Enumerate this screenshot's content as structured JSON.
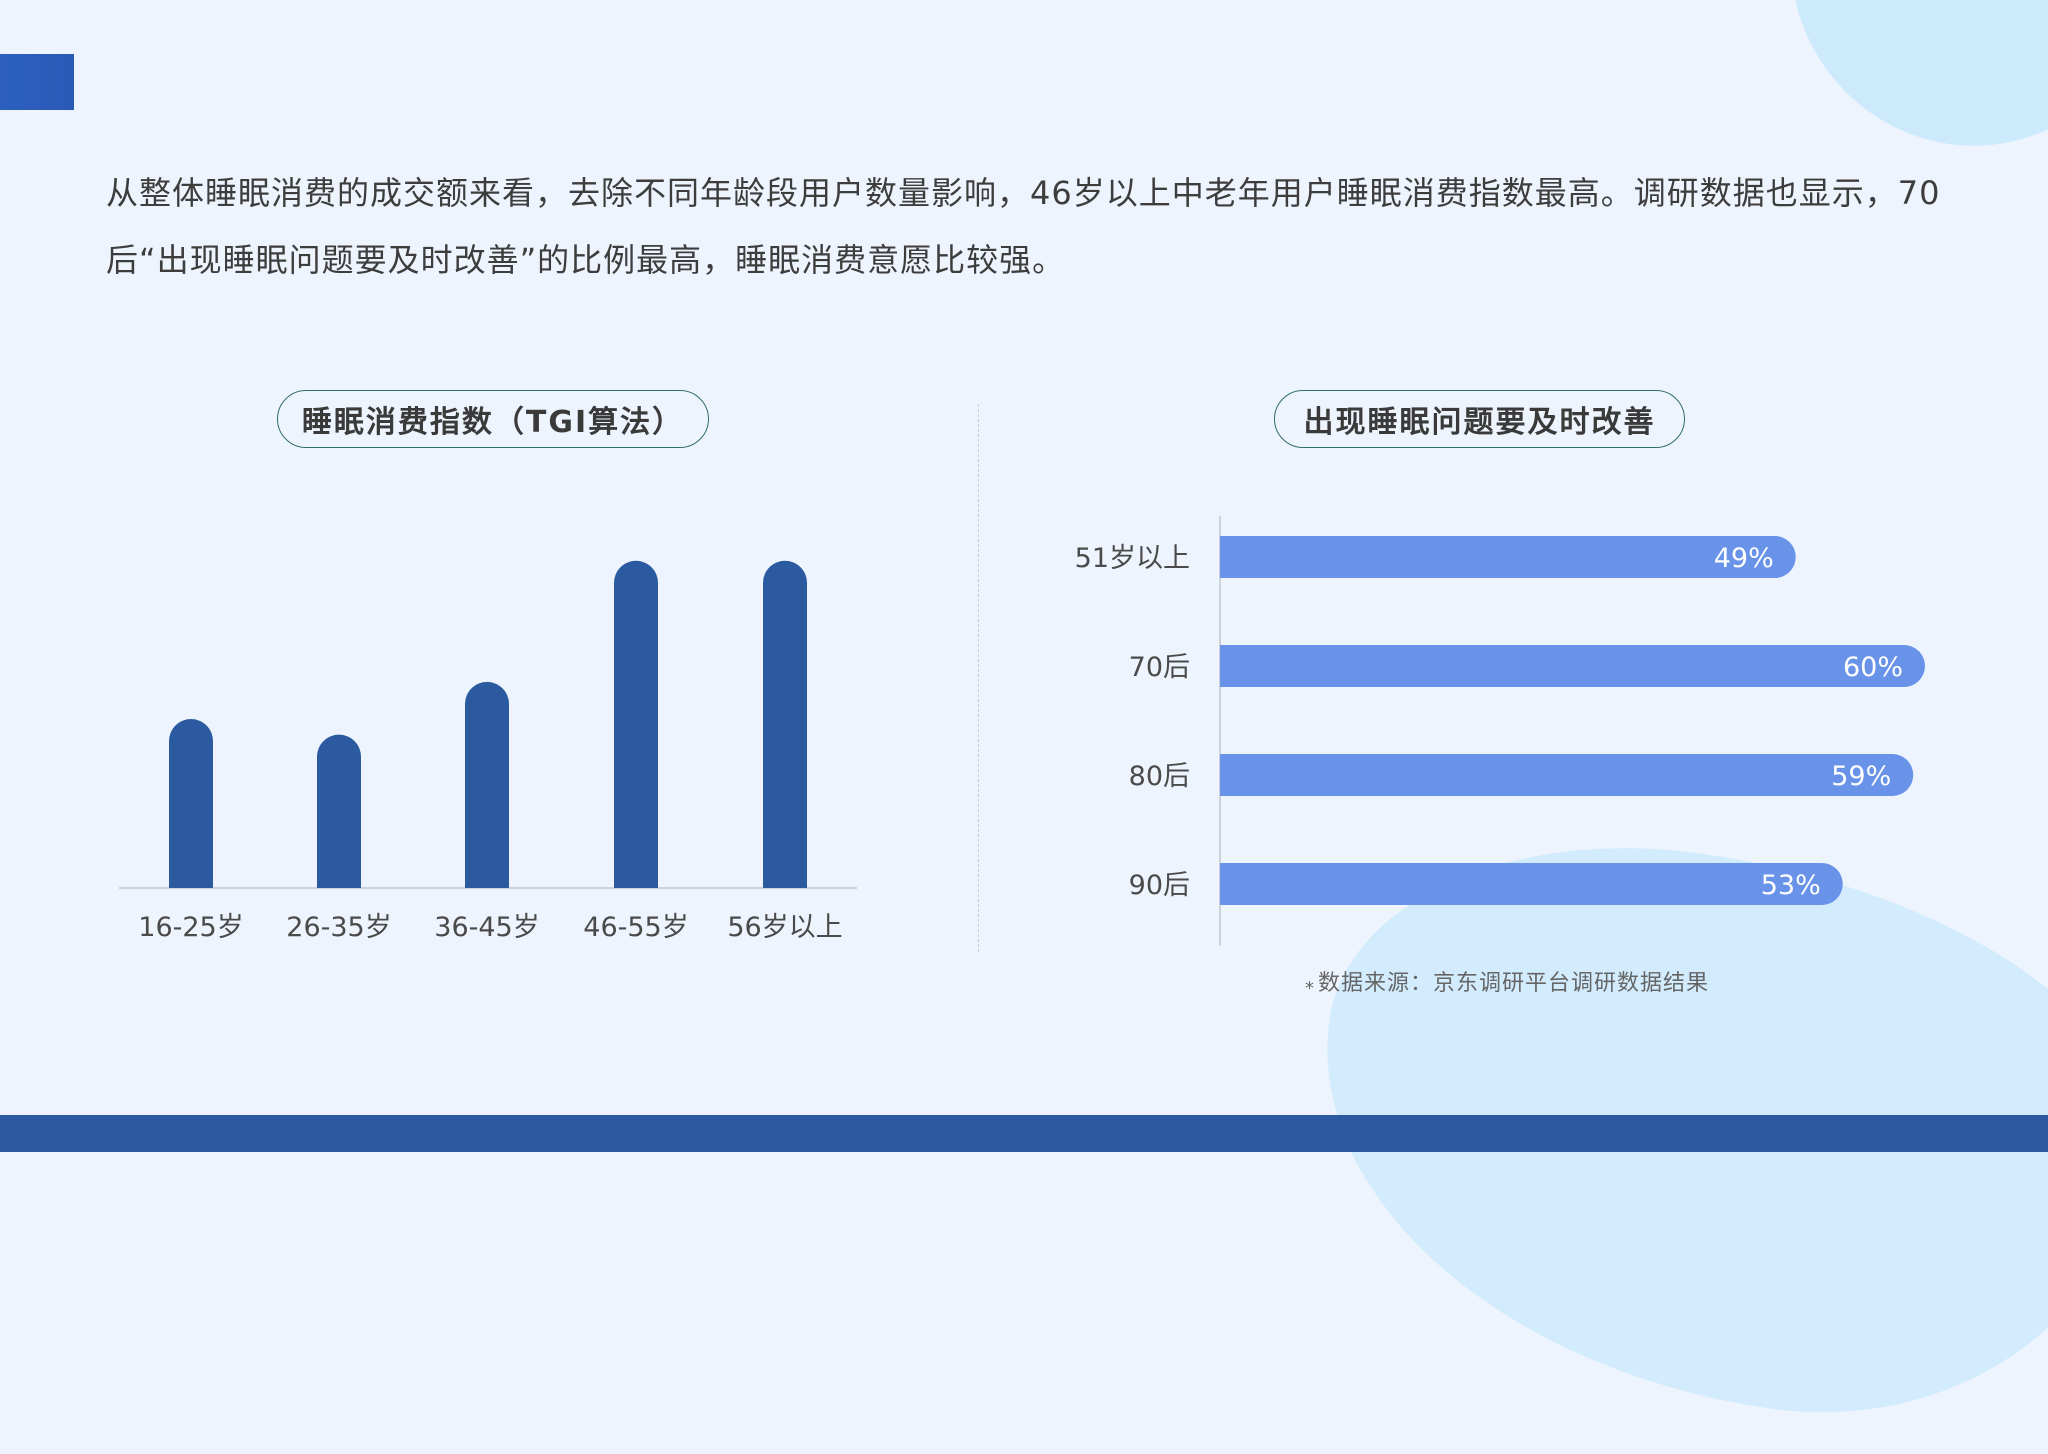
{
  "intro_text": "从整体睡眠消费的成交额来看，去除不同年龄段用户数量影响，46岁以上中老年用户睡眠消费指数最高。调研数据也显示，70后“出现睡眠问题要及时改善”的比例最高，睡眠消费意愿比较强。",
  "source_note": "数据来源：京东调研平台调研数据结果",
  "source_star": "*",
  "colors": {
    "background": "#eef4fd",
    "column_bar": "#2b5aa1",
    "horizontal_bar": "#6893e8",
    "accent": "#2d5fbf",
    "blob": "#cdeafd",
    "pill_border": "#2f6e68"
  },
  "chart_data": [
    {
      "type": "bar",
      "orientation": "vertical",
      "title": "睡眠消费指数（TGI算法）",
      "categories": [
        "16-25岁",
        "26-35岁",
        "36-45岁",
        "46-55岁",
        "56岁以上"
      ],
      "values": [
        173,
        157,
        211,
        335,
        335
      ],
      "ylim": [
        0,
        345
      ],
      "grid": false,
      "y_axis_visible": false,
      "data_labels": false,
      "bar_shape": "rounded-top"
    },
    {
      "type": "bar",
      "orientation": "horizontal",
      "title": "出现睡眠问题要及时改善",
      "categories": [
        "51岁以上",
        "70后",
        "80后",
        "90后"
      ],
      "values": [
        49,
        60,
        59,
        53
      ],
      "value_labels": [
        "49%",
        "60%",
        "59%",
        "53%"
      ],
      "xlim": [
        0,
        60
      ],
      "grid": false,
      "data_labels": true,
      "bar_shape": "rounded-end"
    }
  ]
}
